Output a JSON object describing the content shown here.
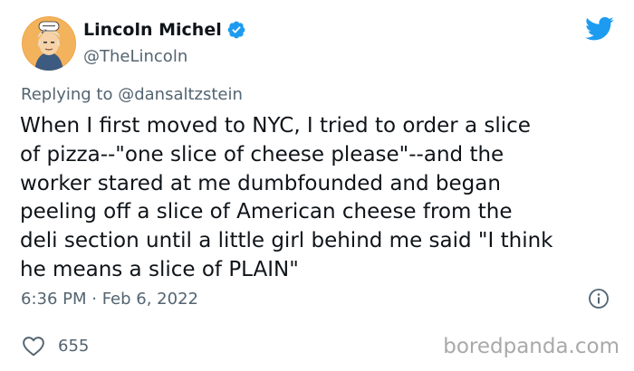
{
  "author": {
    "name": "Lincoln Michel",
    "handle": "@TheLincoln",
    "verified": true,
    "avatar_icon": "comic-portrait-avatar"
  },
  "reply": {
    "prefix": "Replying to",
    "user": "@dansaltzstein"
  },
  "tweet": {
    "lines": [
      "When I first moved to NYC, I tried to order a slice",
      "of pizza--\"one slice of cheese please\"--and the",
      "worker stared at me dumbfounded and began",
      "peeling off a slice of American cheese from the",
      "deli section until a little girl behind me said \"I think",
      "he means a slice of PLAIN\""
    ],
    "timestamp": "6:36 PM · Feb 6, 2022",
    "likes": "655"
  },
  "icons": {
    "logo": "twitter-bird-icon",
    "verified": "verified-badge-icon",
    "info": "info-icon",
    "like": "heart-icon"
  },
  "colors": {
    "twitter_blue": "#1d9bf0",
    "secondary_text": "#536471",
    "watermark": "#a9a9a9"
  },
  "watermark": "boredpanda.com"
}
